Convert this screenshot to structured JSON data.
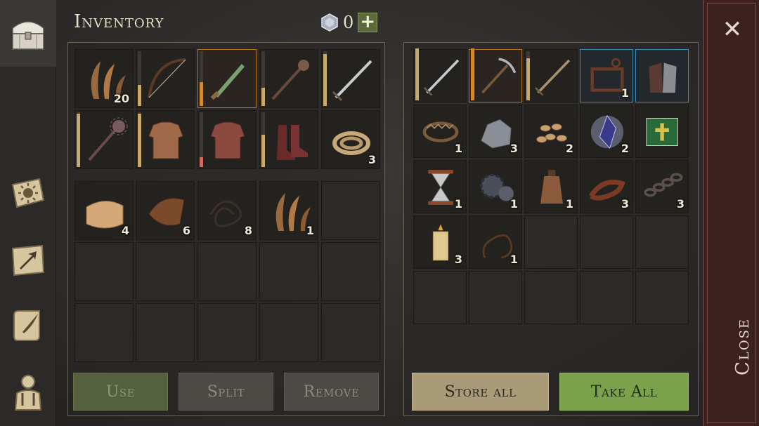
{
  "header": {
    "title": "Inventory",
    "currency_count": "0",
    "add_currency_symbol": "+"
  },
  "sidebar": {
    "tabs": [
      {
        "name": "chest",
        "icon": "chest-icon",
        "active": true
      },
      {
        "name": "skills",
        "icon": "sun-book-icon",
        "active": false
      },
      {
        "name": "craft",
        "icon": "arrow-map-icon",
        "active": false
      },
      {
        "name": "journal",
        "icon": "scroll-quill-icon",
        "active": false
      },
      {
        "name": "character",
        "icon": "character-icon",
        "active": false
      }
    ]
  },
  "inventory": {
    "equipment_slots": [
      {
        "item": "plant-fibers",
        "qty": "20"
      },
      {
        "item": "bow",
        "qty": ""
      },
      {
        "item": "dagger",
        "qty": ""
      },
      {
        "item": "mace",
        "qty": ""
      },
      {
        "item": "sword",
        "qty": ""
      },
      {
        "item": "spiked-mace",
        "qty": ""
      },
      {
        "item": "padded-armor",
        "qty": ""
      },
      {
        "item": "chainmail",
        "qty": ""
      },
      {
        "item": "boots",
        "qty": ""
      },
      {
        "item": "rope",
        "qty": "3"
      }
    ],
    "bag_slots": [
      {
        "item": "cloth",
        "qty": "4"
      },
      {
        "item": "leather",
        "qty": "6"
      },
      {
        "item": "cord",
        "qty": "8"
      },
      {
        "item": "plant-fibers",
        "qty": "1"
      }
    ],
    "buttons": {
      "use": "Use",
      "split": "Split",
      "remove": "Remove"
    }
  },
  "container": {
    "slots": [
      {
        "item": "sword",
        "qty": ""
      },
      {
        "item": "pickaxe",
        "qty": ""
      },
      {
        "item": "long-sword",
        "qty": ""
      },
      {
        "item": "torture-device",
        "qty": "1"
      },
      {
        "item": "gauntlets",
        "qty": ""
      },
      {
        "item": "bear-trap",
        "qty": "1"
      },
      {
        "item": "iron-ore",
        "qty": "3"
      },
      {
        "item": "seeds",
        "qty": "2"
      },
      {
        "item": "crystal",
        "qty": "2"
      },
      {
        "item": "holy-book",
        "qty": ""
      },
      {
        "item": "hourglass",
        "qty": "1"
      },
      {
        "item": "gear-mechanism",
        "qty": "1"
      },
      {
        "item": "flask",
        "qty": "1"
      },
      {
        "item": "leather-strap",
        "qty": "3"
      },
      {
        "item": "chain",
        "qty": "3"
      },
      {
        "item": "candle",
        "qty": "3"
      },
      {
        "item": "whip",
        "qty": "1"
      }
    ],
    "buttons": {
      "store_all": "Store all",
      "take_all": "Take All"
    }
  },
  "close": {
    "label": "Close",
    "x_symbol": "✕"
  }
}
